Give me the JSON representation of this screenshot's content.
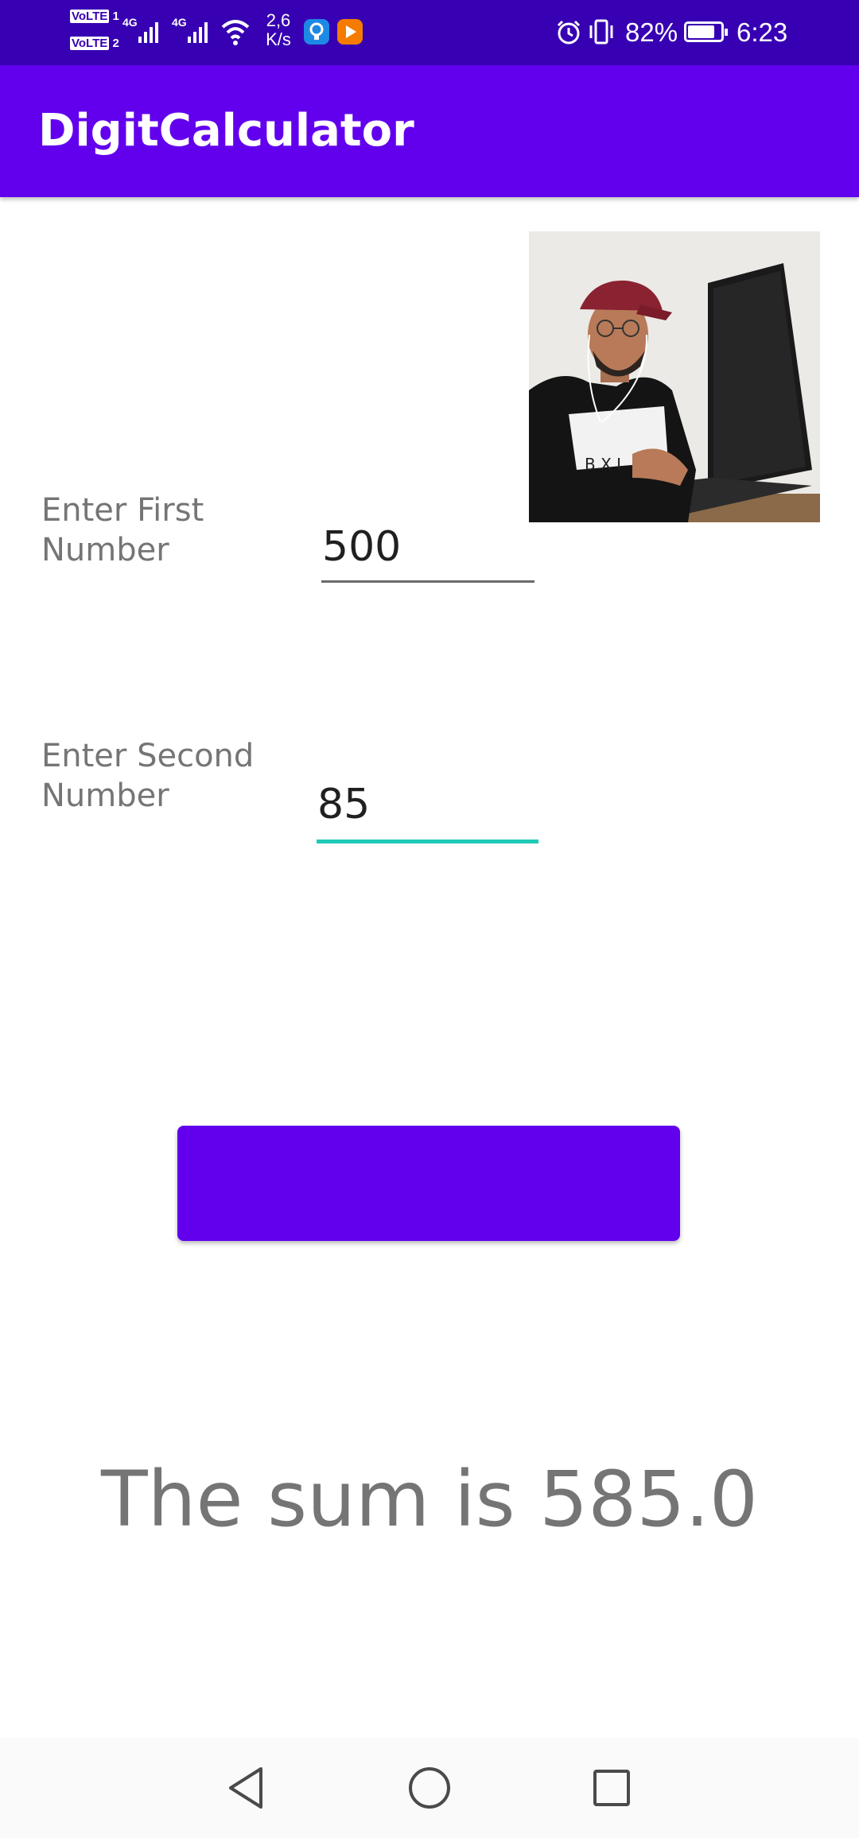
{
  "status_bar": {
    "sim1_label": "VoLTE",
    "sim1_index": "1",
    "sim2_label": "VoLTE",
    "sim2_index": "2",
    "net1": "4G",
    "net2": "4G",
    "speed_value": "2,6",
    "speed_unit": "K/s",
    "battery_percent": "82%",
    "battery_level": 0.82,
    "time": "6:23",
    "icons": [
      "signal-icon",
      "wifi-icon",
      "tips-app-icon",
      "video-app-icon",
      "alarm-icon",
      "vibrate-icon",
      "battery-icon"
    ]
  },
  "app_bar": {
    "title": "DigitCalculator"
  },
  "photo": {
    "description_icon": "user-photo"
  },
  "form": {
    "first_label": "Enter First\nNumber",
    "first_value": "500",
    "second_label": "Enter Second\nNumber",
    "second_value": "85"
  },
  "button": {
    "label": ""
  },
  "result": {
    "text": "The sum is 585.0"
  },
  "colors": {
    "status_bar": "#3700B3",
    "app_bar": "#6200EE",
    "button": "#6200EE",
    "focused_underline": "#1FC9B8",
    "label_text": "#757575"
  },
  "nav_bar": {
    "icons": [
      "back-icon",
      "home-icon",
      "recents-icon"
    ]
  }
}
